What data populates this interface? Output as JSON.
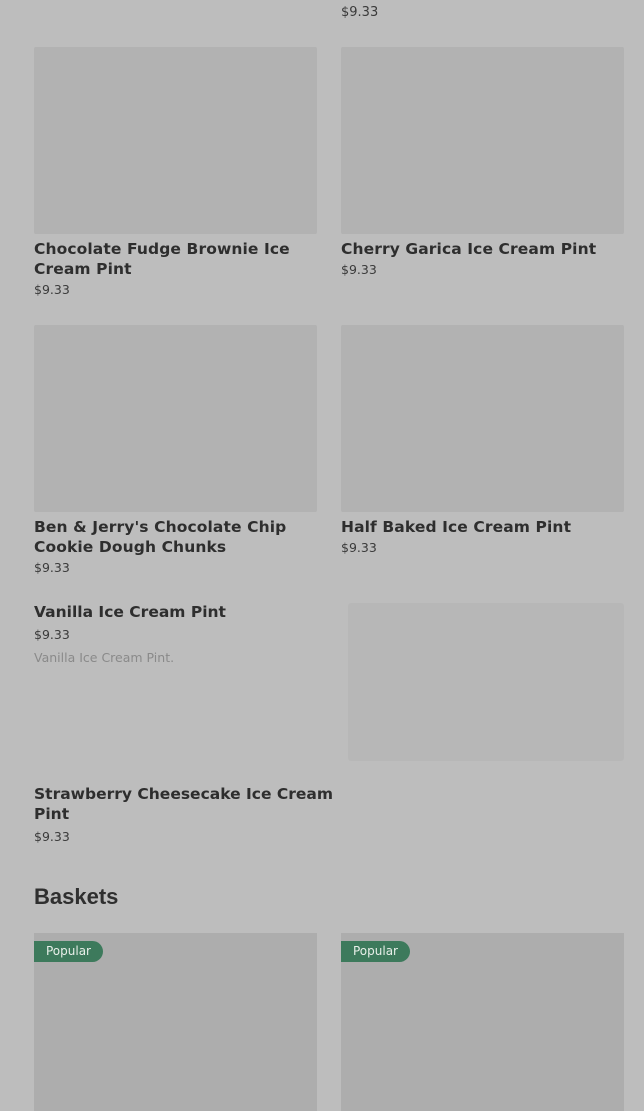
{
  "top": {
    "right_price": "$9.33"
  },
  "grid": [
    {
      "title": "Chocolate Fudge Brownie Ice Cream Pint",
      "price": "$9.33"
    },
    {
      "title": "Cherry Garica Ice Cream Pint",
      "price": "$9.33"
    },
    {
      "title": "Ben & Jerry's Chocolate Chip Cookie Dough Chunks",
      "price": "$9.33"
    },
    {
      "title": "Half Baked Ice Cream Pint",
      "price": "$9.33"
    }
  ],
  "list": [
    {
      "title": "Vanilla Ice Cream Pint",
      "price": "$9.33",
      "description": "Vanilla Ice Cream Pint."
    },
    {
      "title": "Strawberry Cheesecake Ice Cream Pint",
      "price": "$9.33"
    }
  ],
  "baskets": {
    "heading": "Baskets",
    "items": [
      {
        "badge": "Popular"
      },
      {
        "badge": "Popular"
      }
    ]
  }
}
